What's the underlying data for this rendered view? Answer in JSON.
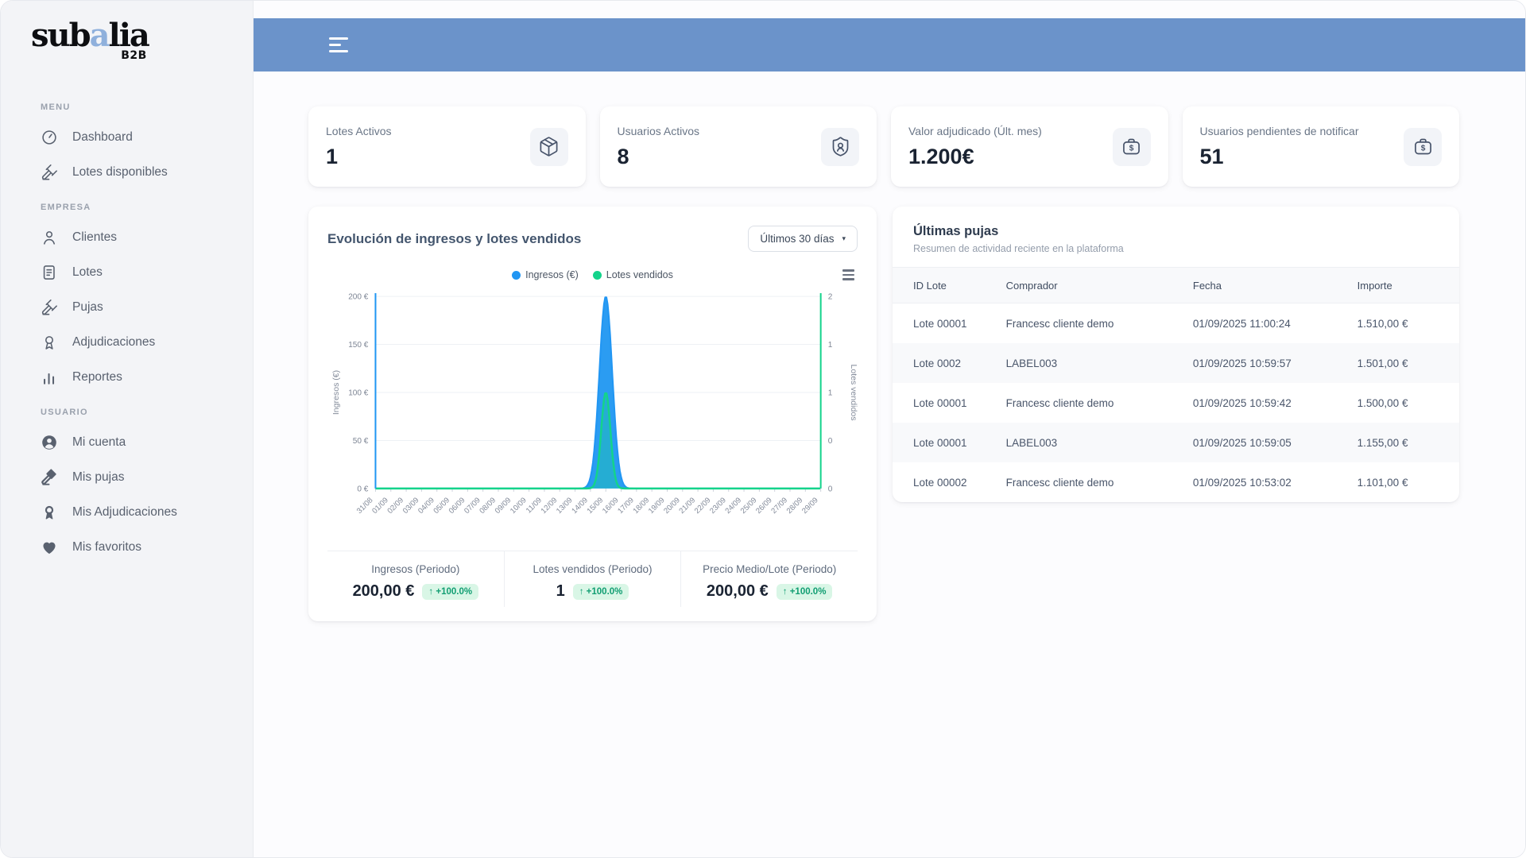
{
  "brand": {
    "name_pre": "sub",
    "name_accent": "a",
    "name_post": "lia",
    "tagline": "B2B"
  },
  "colors": {
    "header_blue": "#6b93ca",
    "logo_accent": "#8fb0dc",
    "series_blue": "#2196f3",
    "series_green": "#14d38b",
    "badge_bg": "#d9f6e6",
    "badge_text": "#119e72"
  },
  "sidebar": {
    "sections": [
      {
        "label": "MENU",
        "items": [
          {
            "icon": "gauge",
            "label": "Dashboard"
          },
          {
            "icon": "gavel",
            "label": "Lotes disponibles"
          }
        ]
      },
      {
        "label": "EMPRESA",
        "items": [
          {
            "icon": "user",
            "label": "Clientes"
          },
          {
            "icon": "file",
            "label": "Lotes"
          },
          {
            "icon": "gavel",
            "label": "Pujas"
          },
          {
            "icon": "medal",
            "label": "Adjudicaciones"
          },
          {
            "icon": "bar-chart",
            "label": "Reportes"
          }
        ]
      },
      {
        "label": "USUARIO",
        "items": [
          {
            "icon": "user-filled",
            "label": "Mi cuenta"
          },
          {
            "icon": "gavel-filled",
            "label": "Mis pujas"
          },
          {
            "icon": "medal-filled",
            "label": "Mis Adjudicaciones"
          },
          {
            "icon": "heart-filled",
            "label": "Mis favoritos"
          }
        ]
      }
    ]
  },
  "stats": [
    {
      "label": "Lotes Activos",
      "value": "1",
      "icon": "package"
    },
    {
      "label": "Usuarios Activos",
      "value": "8",
      "icon": "shield-user"
    },
    {
      "label": "Valor adjudicado (Últ. mes)",
      "value": "1.200€",
      "icon": "briefcase-dollar"
    },
    {
      "label": "Usuarios pendientes de notificar",
      "value": "51",
      "icon": "briefcase-dollar"
    }
  ],
  "chart_card": {
    "title": "Evolución de ingresos y lotes vendidos",
    "range": {
      "label": "Últimos 30 días",
      "caret": "▾"
    },
    "legend": [
      {
        "label": "Ingresos (€)",
        "color": "#2196f3"
      },
      {
        "label": "Lotes vendidos",
        "color": "#14d38b"
      }
    ],
    "footer_stats": [
      {
        "label": "Ingresos (Periodo)",
        "value": "200,00 €",
        "badge": "↑ +100.0%"
      },
      {
        "label": "Lotes vendidos (Periodo)",
        "value": "1",
        "badge": "↑ +100.0%"
      },
      {
        "label": "Precio Medio/Lote (Periodo)",
        "value": "200,00 €",
        "badge": "↑ +100.0%"
      }
    ]
  },
  "chart_data": {
    "type": "area",
    "title": "Evolución de ingresos y lotes vendidos",
    "legend_position": "top",
    "grid": true,
    "x": [
      "31/08",
      "01/09",
      "02/09",
      "03/09",
      "04/09",
      "05/09",
      "06/09",
      "07/09",
      "08/09",
      "09/09",
      "10/09",
      "11/09",
      "12/09",
      "13/09",
      "14/09",
      "15/09",
      "16/09",
      "17/09",
      "18/09",
      "19/09",
      "20/09",
      "21/09",
      "22/09",
      "23/09",
      "24/09",
      "25/09",
      "26/09",
      "27/09",
      "28/09",
      "29/09"
    ],
    "series": [
      {
        "name": "Ingresos (€)",
        "axis": "left",
        "color": "#2196f3",
        "fill": "#2b9cf2",
        "values": [
          0,
          0,
          0,
          0,
          0,
          0,
          0,
          0,
          0,
          0,
          0,
          0,
          0,
          0,
          0,
          200,
          0,
          0,
          0,
          0,
          0,
          0,
          0,
          0,
          0,
          0,
          0,
          0,
          0,
          0
        ]
      },
      {
        "name": "Lotes vendidos",
        "axis": "right",
        "color": "#14d38b",
        "fill": "rgba(23,211,140,0.30)",
        "values": [
          0,
          0,
          0,
          0,
          0,
          0,
          0,
          0,
          0,
          0,
          0,
          0,
          0,
          0,
          0,
          1,
          0,
          0,
          0,
          0,
          0,
          0,
          0,
          0,
          0,
          0,
          0,
          0,
          0,
          0
        ]
      }
    ],
    "ylabel_left": "Ingresos (€)",
    "ylabel_right": "Lotes vendidos",
    "ylim_left": [
      0,
      200
    ],
    "ylim_right": [
      0,
      2
    ],
    "yticks_left": [
      "0 €",
      "50 €",
      "100 €",
      "150 €",
      "200 €"
    ],
    "yticks_right": [
      "0",
      "0",
      "1",
      "1",
      "2"
    ]
  },
  "pujas": {
    "title": "Últimas pujas",
    "subtitle": "Resumen de actividad reciente en la plataforma",
    "columns": [
      "ID Lote",
      "Comprador",
      "Fecha",
      "Importe"
    ],
    "rows": [
      {
        "id": "Lote 00001",
        "comprador": "Francesc cliente demo",
        "fecha": "01/09/2025 11:00:24",
        "importe": "1.510,00 €"
      },
      {
        "id": "Lote 0002",
        "comprador": "LABEL003",
        "fecha": "01/09/2025 10:59:57",
        "importe": "1.501,00 €"
      },
      {
        "id": "Lote 00001",
        "comprador": "Francesc cliente demo",
        "fecha": "01/09/2025 10:59:42",
        "importe": "1.500,00 €"
      },
      {
        "id": "Lote 00001",
        "comprador": "LABEL003",
        "fecha": "01/09/2025 10:59:05",
        "importe": "1.155,00 €"
      },
      {
        "id": "Lote 00002",
        "comprador": "Francesc cliente demo",
        "fecha": "01/09/2025 10:53:02",
        "importe": "1.101,00 €"
      }
    ]
  }
}
